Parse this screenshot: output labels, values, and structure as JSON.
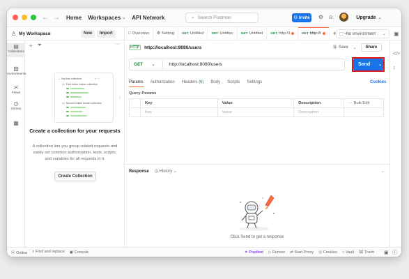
{
  "titlebar": {
    "nav": [
      {
        "label": "Home"
      },
      {
        "label": "Workspaces",
        "has_chevron": true
      },
      {
        "label": "API Network"
      }
    ],
    "search_placeholder": "Search Postman",
    "invite_label": "Invite",
    "upgrade_label": "Upgrade"
  },
  "workspace": {
    "name": "My Workspace",
    "new_label": "New",
    "import_label": "Import"
  },
  "tabs": [
    {
      "method": "",
      "label": "Overview",
      "icon": "overview-icon"
    },
    {
      "method": "",
      "label": "Setting",
      "icon": "settings-icon"
    },
    {
      "method": "GET",
      "label": "Untitled"
    },
    {
      "method": "GET",
      "label": "Untitlec"
    },
    {
      "method": "GET",
      "label": "Untitled"
    },
    {
      "method": "GET",
      "label": "http://l",
      "dot": true
    },
    {
      "method": "GET",
      "label": "http://l",
      "dot": true,
      "active": true
    }
  ],
  "environment": "No environment",
  "rail": [
    {
      "label": "Collections",
      "icon": "collections-icon",
      "active": true
    },
    {
      "label": "Environments",
      "icon": "environments-icon"
    },
    {
      "label": "Flows",
      "icon": "flows-icon"
    },
    {
      "label": "History",
      "icon": "history-icon"
    },
    {
      "label": "",
      "icon": "apps-icon"
    }
  ],
  "sidebar": {
    "illustration": {
      "collection": "My first collection",
      "folder1": "First folder inside collection",
      "folder2": "Second folder inside collection"
    },
    "empty_title": "Create a collection for your requests",
    "empty_desc": "A collection lets you group related requests and easily set common authorization, tests, scripts, and variables for all requests in it.",
    "create_label": "Create Collection"
  },
  "request": {
    "title": "http://localhost:8080/users",
    "save_label": "Save",
    "share_label": "Share",
    "method": "GET",
    "url": "http://localhost:8080/users",
    "send_label": "Send",
    "tabs": [
      {
        "label": "Params",
        "active": true
      },
      {
        "label": "Authorization"
      },
      {
        "label": "Headers",
        "count": "(6)"
      },
      {
        "label": "Body"
      },
      {
        "label": "Scripts"
      },
      {
        "label": "Settings"
      }
    ],
    "cookies_label": "Cookies",
    "query_title": "Query Params",
    "table_headers": [
      "Key",
      "Value",
      "Description"
    ],
    "bulk_edit": "Bulk Edit",
    "placeholders": [
      "Key",
      "Value",
      "Description"
    ]
  },
  "response": {
    "title": "Response",
    "history_label": "History",
    "empty_text": "Click Send to get a response"
  },
  "status": {
    "left": [
      {
        "label": "Online",
        "icon": "online-icon"
      },
      {
        "label": "Find and replace",
        "icon": "search-icon"
      },
      {
        "label": "Console",
        "icon": "console-icon"
      }
    ],
    "right": [
      {
        "label": "Postbot",
        "icon": "postbot-icon"
      },
      {
        "label": "Runner",
        "icon": "runner-icon"
      },
      {
        "label": "Start Proxy",
        "icon": "proxy-icon"
      },
      {
        "label": "Cookies",
        "icon": "cookies-icon"
      },
      {
        "label": "Vault",
        "icon": "vault-icon"
      },
      {
        "label": "Trash",
        "icon": "trash-icon"
      }
    ]
  },
  "colors": {
    "accent": "#ff6c37",
    "send_blue": "#1a73e8",
    "highlight_red": "#d9191b",
    "get_green": "#1b8a3a"
  }
}
